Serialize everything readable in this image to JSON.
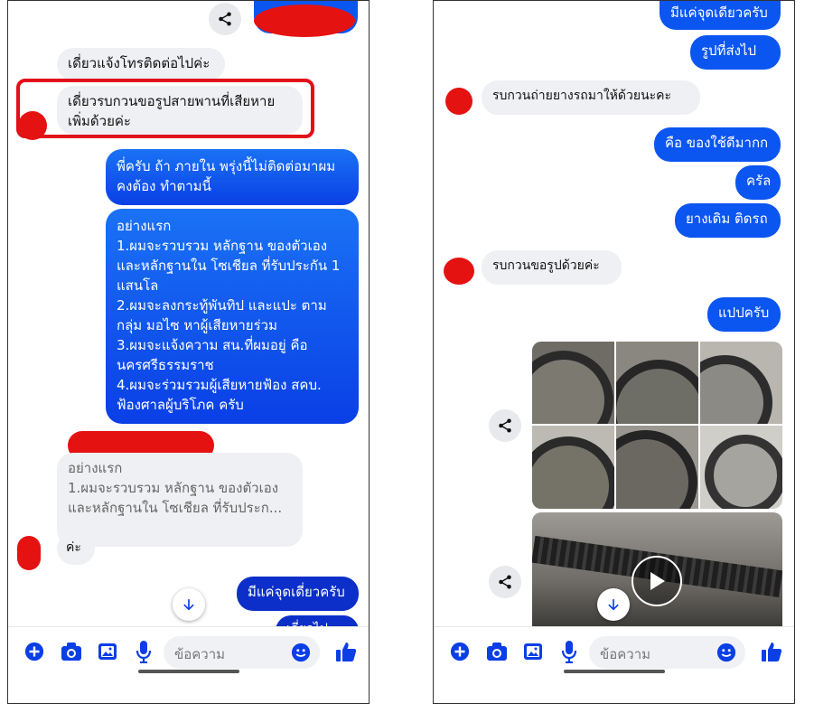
{
  "left": {
    "messages": {
      "m1": "เดี่ยวแจ้งโทรติดต่อไปค่ะ",
      "m2": "เดี่ยวรบกวนขอรูปสายพานที่เสียหายเพิ่มด้วยค่ะ",
      "m3": "พี่ครับ ถ้า ภายใน พรุ่งนี้ไม่ติดต่อมาผมคงต้อง ทำตามนี้",
      "m4": "อย่างแรก\n1.ผมจะรวบรวม หลักฐาน ของตัวเองและหลักฐานใน โซเชียล ที่รับประกัน 1 แสนโล\n2.ผมจะลงกระทู้พันทิป และแปะ ตาม กลุ่ม มอไซ หาผู้เสียหายร่วม\n3.ผมจะแจ้งความ สน.ที่ผมอยู่ คือ นครศรีธรรมราช\n4.ผมจะร่วมรวมผู้เสียหายฟ้อง สคบ. ฟ้องศาลผู้บริโภค ครับ",
      "quote": "อย่างแรก\n1.ผมจะรวบรวม หลักฐาน ของตัวเองและหลักฐานใน โซเชียล ที่รับประก...",
      "reply": "ค่ะ",
      "m5": "มีแค่จุดเดี่ยวครับ",
      "m6": "เดี่ยวไป"
    },
    "composer": {
      "placeholder": "ข้อความ"
    }
  },
  "right": {
    "messages": {
      "r1": "มีแค่จุดเดียวครับ",
      "r2": "รูปที่ส่งไป",
      "r3": "รบกวนถ่ายยางรถมาให้ด้วยนะคะ",
      "r4": "คือ ของใช้ดีมากก",
      "r5": "ครัล",
      "r6": "ยางเดิม ติดรถ",
      "r7": "รบกวนขอรูปด้วยค่ะ",
      "r8": "แปปครับ"
    },
    "composer": {
      "placeholder": "ข้อความ"
    }
  },
  "colors": {
    "accent": "#0b55f0",
    "incoming": "#eff0f3",
    "highlight": "#e0101b"
  },
  "icons": [
    "share-icon",
    "chevron-down-icon",
    "plus-circle-icon",
    "camera-icon",
    "image-icon",
    "microphone-icon",
    "emoji-icon",
    "thumbs-up-icon",
    "play-icon"
  ]
}
